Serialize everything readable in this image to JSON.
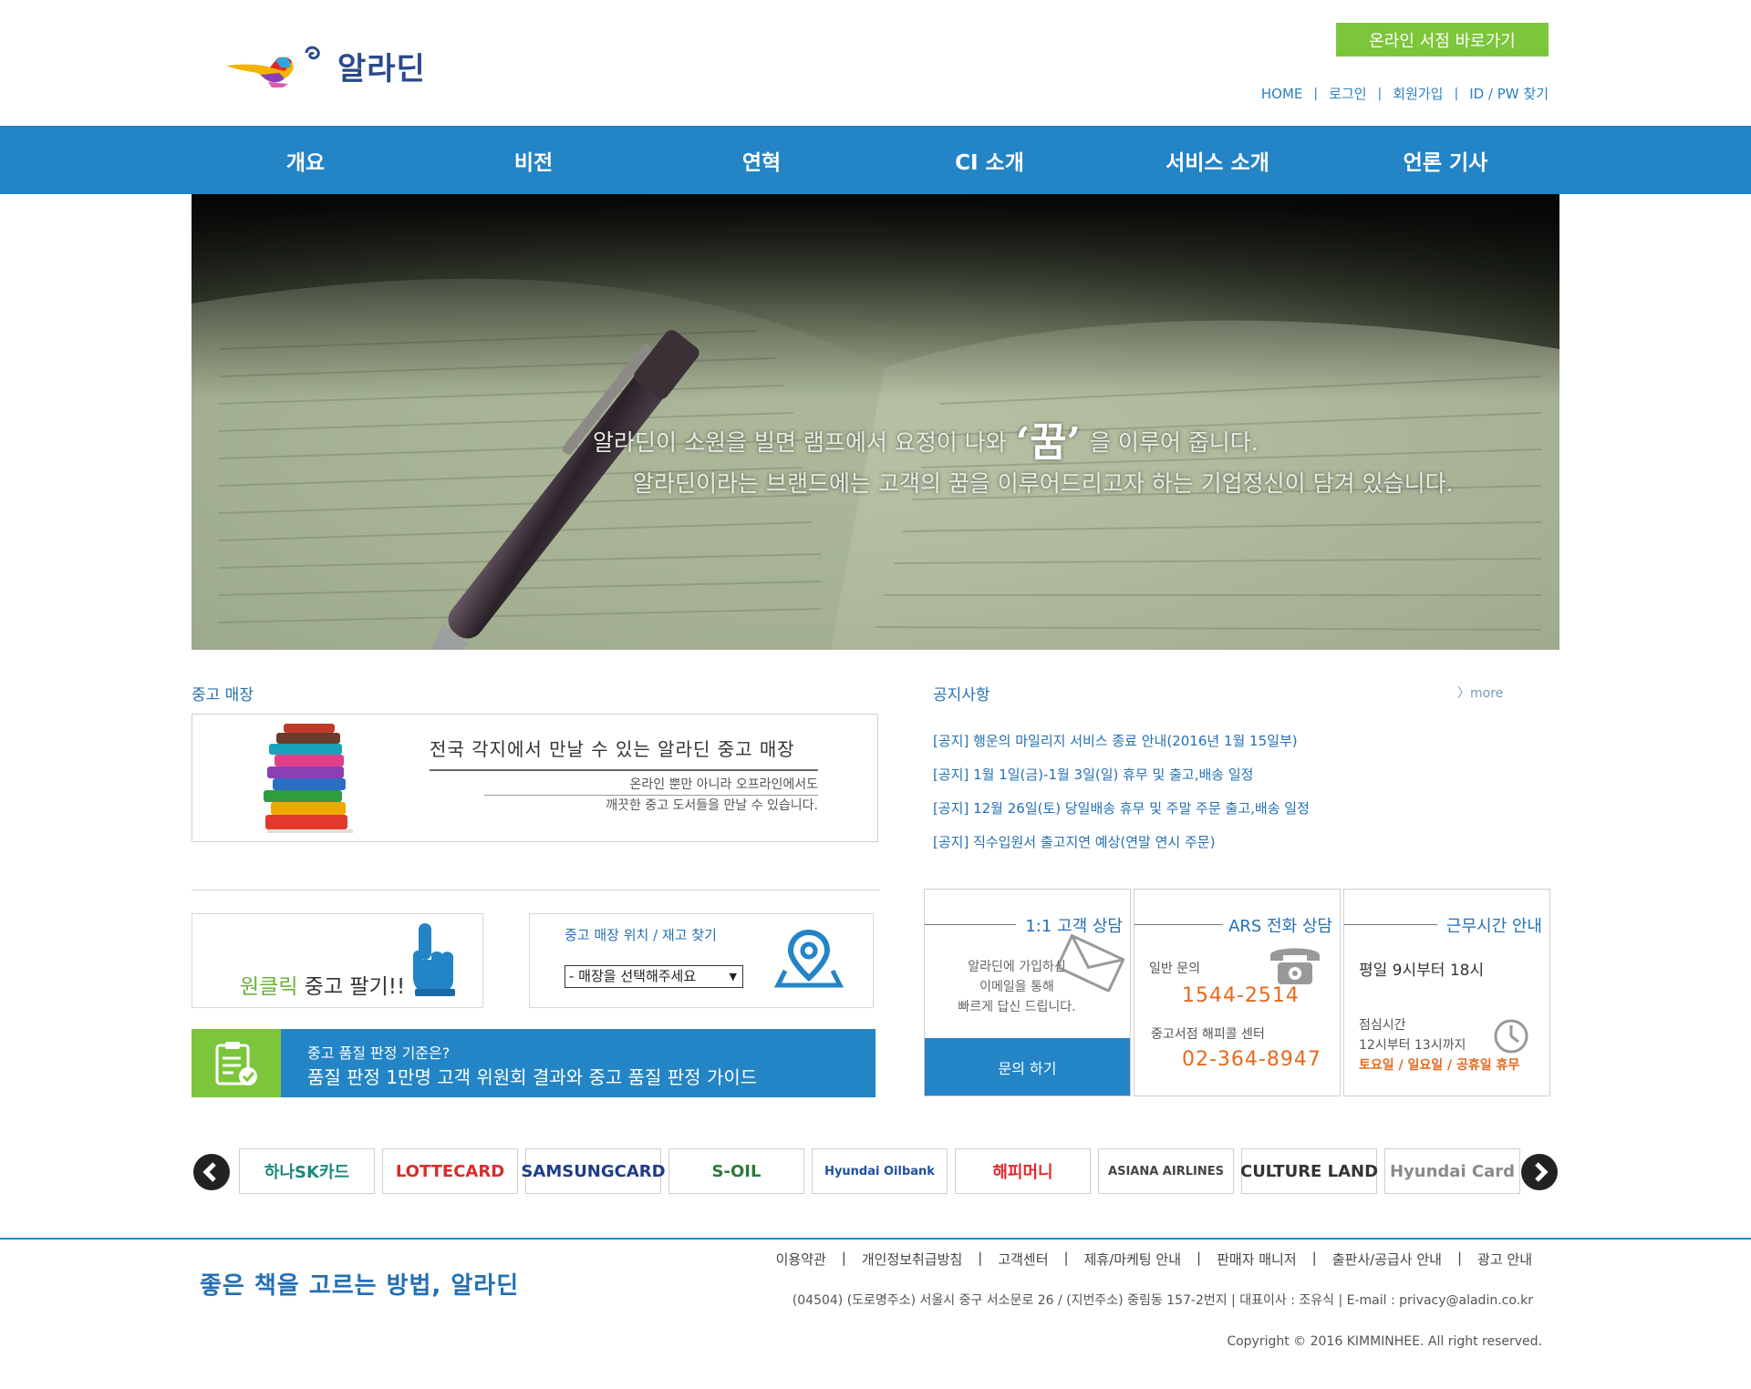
{
  "header": {
    "logo_text": "알라딘",
    "online_store_button": "온라인 서점 바로가기",
    "top_links": [
      "HOME",
      "로그인",
      "회원가입",
      "ID / PW 찾기"
    ]
  },
  "nav": {
    "items": [
      "개요",
      "비전",
      "연혁",
      "CI 소개",
      "서비스 소개",
      "언론 기사"
    ]
  },
  "hero": {
    "line1_before": "알라딘이 소원을 빌면 램프에서 요정이 나와",
    "line1_keyword": "‘꿈’",
    "line1_after": "을 이루어 줍니다.",
    "line2": "알라딘이라는 브랜드에는 고객의 꿈을 이루어드리고자 하는 기업정신이 담겨 있습니다."
  },
  "used_store": {
    "section_title": "중고 매장",
    "heading": "전국 각지에서 만날 수 있는 알라딘 중고 매장",
    "sub_line1": "온라인 뿐만 아니라 오프라인에서도",
    "sub_line2": "깨끗한 중고 도서들을 만날 수 있습니다."
  },
  "notices": {
    "section_title": "공지사항",
    "more": "more",
    "items": [
      "[공지] 행운의 마일리지 서비스 종료 안내(2016년 1월 15일부)",
      "[공지] 1월 1일(금)-1월 3일(일) 휴무 및 출고,배송 일정",
      "[공지] 12월 26일(토) 당일배송 휴무 및 주말 주문 출고,배송 일정",
      "[공지] 직수입원서 출고지연 예상(연말 연시 주문)"
    ]
  },
  "one_click": {
    "green": "원클릭",
    "rest": " 중고 팔기!!"
  },
  "store_finder": {
    "title": "중고 매장 위치 / 재고 찾기",
    "select_value": "- 매장을 선택해주세요"
  },
  "quality": {
    "line1": "중고 품질 판정 기준은?",
    "line2": "품질 판정 1만명 고객 위원회 결과와 중고 품질 판정 가이드"
  },
  "contact": {
    "cs": {
      "title": "1:1 고객 상담",
      "body1": "알라딘에 가입하신",
      "body2": "이메일을 통해",
      "body3": "빠르게 답신 드립니다.",
      "button": "문의 하기"
    },
    "ars": {
      "title": "ARS 전화 상담",
      "label1": "일반 문의",
      "number1": "1544-2514",
      "label2": "중고서점 해피콜 센터",
      "number2": "02-364-8947"
    },
    "hours": {
      "title": "근무시간 안내",
      "weekday": "평일  9시부터 18시",
      "lunch_label": "점심시간",
      "lunch_time": "12시부터 13시까지",
      "off": "토요일 / 일요일 / 공휴일 휴무"
    }
  },
  "partners": [
    {
      "name": "하나SK카드",
      "color": "#1a8a7a"
    },
    {
      "name": "LOTTECARD",
      "color": "#d72c2c"
    },
    {
      "name": "SAMSUNGCARD",
      "color": "#1f3c88"
    },
    {
      "name": "S-OIL",
      "color": "#2a7a3a"
    },
    {
      "name": "Hyundai Oilbank",
      "color": "#1f4fa0"
    },
    {
      "name": "해피머니",
      "color": "#e3262a"
    },
    {
      "name": "ASIANA AIRLINES",
      "color": "#444444"
    },
    {
      "name": "CULTURE LAND",
      "color": "#333333"
    },
    {
      "name": "Hyundai Card",
      "color": "#8a8a8a"
    }
  ],
  "footer": {
    "slogan": "좋은 책을 고르는 방법, 알라딘",
    "links": [
      "이용약관",
      "개인정보취급방침",
      "고객센터",
      "제휴/마케팅 안내",
      "판매자 매니저",
      "출판사/공급사 안내",
      "광고 안내"
    ],
    "address": "(04504) (도로명주소) 서울시 중구 서소문로 26 / (지번주소) 중림동 157-2번지 | 대표이사 : 조유식 | E-mail : privacy@aladin.co.kr",
    "copyright": "Copyright © 2016 KIMMINHEE. All right reserved."
  },
  "colors": {
    "brand_blue": "#2384c6",
    "brand_green": "#7cc63b",
    "accent_orange": "#e36a1e"
  }
}
